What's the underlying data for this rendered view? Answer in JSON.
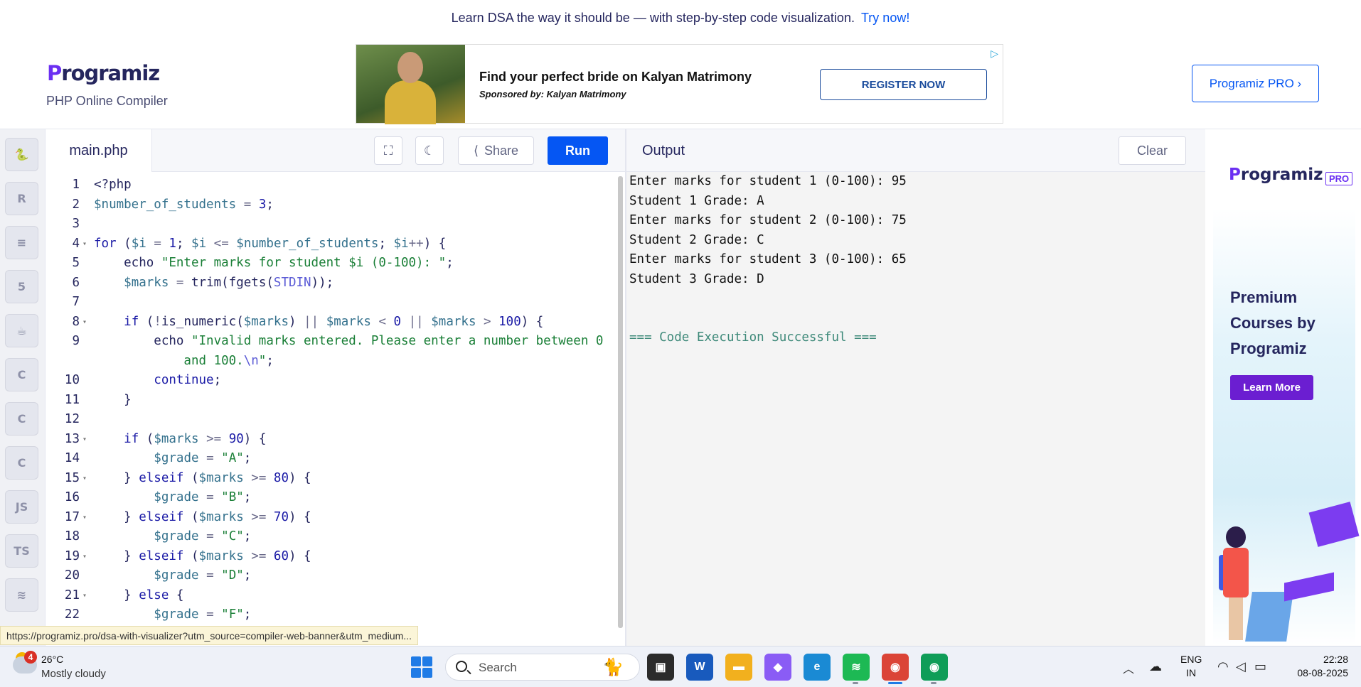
{
  "banner": {
    "text": "Learn DSA the way it should be — with step-by-step code visualization.",
    "link": "Try now!"
  },
  "header": {
    "logo": "rogramiz",
    "logo_p": "P",
    "subtitle": "PHP Online Compiler",
    "pro_button": "Programiz PRO ›"
  },
  "ad": {
    "title": "Find your perfect bride on Kalyan Matrimony",
    "sponsor": "Sponsored by: Kalyan Matrimony",
    "button": "REGISTER NOW",
    "choice_icon": "adchoices-icon"
  },
  "sidebar": {
    "languages": [
      {
        "name": "python",
        "glyph": "🐍"
      },
      {
        "name": "r",
        "glyph": "R"
      },
      {
        "name": "sql",
        "glyph": "≡"
      },
      {
        "name": "html",
        "glyph": "5"
      },
      {
        "name": "java",
        "glyph": "☕"
      },
      {
        "name": "c",
        "glyph": "C"
      },
      {
        "name": "cpp",
        "glyph": "C"
      },
      {
        "name": "csharp",
        "glyph": "C"
      },
      {
        "name": "js",
        "glyph": "JS"
      },
      {
        "name": "ts",
        "glyph": "TS"
      },
      {
        "name": "swift",
        "glyph": "≋"
      }
    ]
  },
  "editor": {
    "file_tab": "main.php",
    "share_label": "Share",
    "run_label": "Run",
    "lines": [
      {
        "n": "1",
        "fold": false,
        "html": "&lt;?php"
      },
      {
        "n": "2",
        "fold": false,
        "html": "<span class=\"var\">$number_of_students</span> <span class=\"op\">=</span> <span class=\"num\">3</span>;"
      },
      {
        "n": "3",
        "fold": false,
        "html": ""
      },
      {
        "n": "4",
        "fold": true,
        "html": "<span class=\"kw\">for</span> (<span class=\"var\">$i</span> <span class=\"op\">=</span> <span class=\"num\">1</span>; <span class=\"var\">$i</span> <span class=\"op\">&lt;=</span> <span class=\"var\">$number_of_students</span>; <span class=\"var\">$i</span><span class=\"op\">++</span>) {"
      },
      {
        "n": "5",
        "fold": false,
        "html": "    echo <span class=\"str\">\"Enter marks for student $i (0-100): \"</span>;"
      },
      {
        "n": "6",
        "fold": false,
        "html": "    <span class=\"var\">$marks</span> <span class=\"op\">=</span> trim(fgets(<span class=\"esc\">STDIN</span>));"
      },
      {
        "n": "7",
        "fold": false,
        "html": ""
      },
      {
        "n": "8",
        "fold": true,
        "html": "    <span class=\"kw\">if</span> (<span class=\"op\">!</span>is_numeric(<span class=\"var\">$marks</span>) <span class=\"op\">||</span> <span class=\"var\">$marks</span> <span class=\"op\">&lt;</span> <span class=\"num\">0</span> <span class=\"op\">||</span> <span class=\"var\">$marks</span> <span class=\"op\">&gt;</span> <span class=\"num\">100</span>) {"
      },
      {
        "n": "9",
        "fold": false,
        "html": "        echo <span class=\"str\">\"Invalid marks entered. Please enter a number between 0</span>"
      },
      {
        "n": "",
        "fold": false,
        "html": "<span class=\"str\">            and 100.</span><span class=\"esc\">\\n</span><span class=\"str\">\"</span>;"
      },
      {
        "n": "10",
        "fold": false,
        "html": "        <span class=\"kw\">continue</span>;"
      },
      {
        "n": "11",
        "fold": false,
        "html": "    }"
      },
      {
        "n": "12",
        "fold": false,
        "html": ""
      },
      {
        "n": "13",
        "fold": true,
        "html": "    <span class=\"kw\">if</span> (<span class=\"var\">$marks</span> <span class=\"op\">&gt;=</span> <span class=\"num\">90</span>) {"
      },
      {
        "n": "14",
        "fold": false,
        "html": "        <span class=\"var\">$grade</span> <span class=\"op\">=</span> <span class=\"str\">\"A\"</span>;"
      },
      {
        "n": "15",
        "fold": true,
        "html": "    } <span class=\"kw\">elseif</span> (<span class=\"var\">$marks</span> <span class=\"op\">&gt;=</span> <span class=\"num\">80</span>) {"
      },
      {
        "n": "16",
        "fold": false,
        "html": "        <span class=\"var\">$grade</span> <span class=\"op\">=</span> <span class=\"str\">\"B\"</span>;"
      },
      {
        "n": "17",
        "fold": true,
        "html": "    } <span class=\"kw\">elseif</span> (<span class=\"var\">$marks</span> <span class=\"op\">&gt;=</span> <span class=\"num\">70</span>) {"
      },
      {
        "n": "18",
        "fold": false,
        "html": "        <span class=\"var\">$grade</span> <span class=\"op\">=</span> <span class=\"str\">\"C\"</span>;"
      },
      {
        "n": "19",
        "fold": true,
        "html": "    } <span class=\"kw\">elseif</span> (<span class=\"var\">$marks</span> <span class=\"op\">&gt;=</span> <span class=\"num\">60</span>) {"
      },
      {
        "n": "20",
        "fold": false,
        "html": "        <span class=\"var\">$grade</span> <span class=\"op\">=</span> <span class=\"str\">\"D\"</span>;"
      },
      {
        "n": "21",
        "fold": true,
        "html": "    } <span class=\"kw\">else</span> {"
      },
      {
        "n": "22",
        "fold": false,
        "html": "        <span class=\"var\">$grade</span> <span class=\"op\">=</span> <span class=\"str\">\"F\"</span>;"
      }
    ]
  },
  "output": {
    "title": "Output",
    "clear_label": "Clear",
    "lines": [
      {
        "text": "Enter marks for student 1 (0-100): 95",
        "success": false
      },
      {
        "text": "Student 1 Grade: A",
        "success": false
      },
      {
        "text": "Enter marks for student 2 (0-100): 75",
        "success": false
      },
      {
        "text": "Student 2 Grade: C",
        "success": false
      },
      {
        "text": "Enter marks for student 3 (0-100): 65",
        "success": false
      },
      {
        "text": "Student 3 Grade: D",
        "success": false
      },
      {
        "text": "",
        "success": false
      },
      {
        "text": "",
        "success": false
      },
      {
        "text": "=== Code Execution Successful ===",
        "success": true
      }
    ]
  },
  "side_ad": {
    "logo": "rogramiz",
    "logo_p": "P",
    "pro_badge": "PRO",
    "text": "Premium Courses by Programiz",
    "button": "Learn More"
  },
  "status_url": "https://programiz.pro/dsa-with-visualizer?utm_source=compiler-web-banner&utm_medium...",
  "taskbar": {
    "weather_temp": "26°C",
    "weather_desc": "Mostly cloudy",
    "weather_badge": "4",
    "search_placeholder": "Search",
    "lang_line1": "ENG",
    "lang_line2": "IN",
    "time": "22:28",
    "date": "08-08-2025",
    "apps": [
      {
        "name": "task-view",
        "glyph": "▣",
        "bg": "#2b2b2b"
      },
      {
        "name": "word",
        "glyph": "W",
        "bg": "#185abd"
      },
      {
        "name": "file-explorer",
        "glyph": "▬",
        "bg": "#f2b01e"
      },
      {
        "name": "copilot",
        "glyph": "◆",
        "bg": "#8a5cf5"
      },
      {
        "name": "edge",
        "glyph": "e",
        "bg": "#1a8ad4"
      },
      {
        "name": "spotify",
        "glyph": "≋",
        "bg": "#1db954"
      },
      {
        "name": "chrome",
        "glyph": "◉",
        "bg": "#db4437"
      },
      {
        "name": "chrome-profile",
        "glyph": "◉",
        "bg": "#0f9d58"
      }
    ]
  },
  "colors": {
    "accent": "#0556f3",
    "brand": "#6b2ff2",
    "success_text": "#3f8a7a"
  }
}
